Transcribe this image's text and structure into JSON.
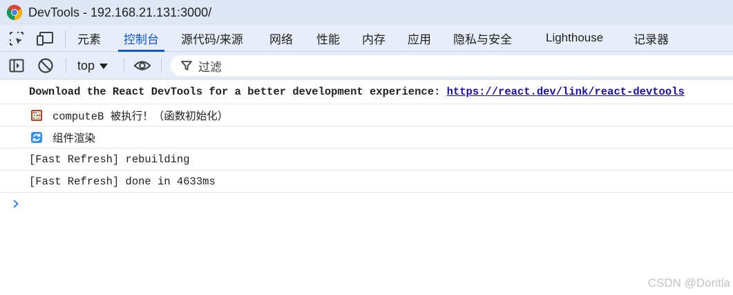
{
  "window": {
    "title": "DevTools - 192.168.21.131:3000/",
    "icon": "chrome-logo"
  },
  "tabs": [
    {
      "label": "元素",
      "active": false
    },
    {
      "label": "控制台",
      "active": true
    },
    {
      "label": "源代码/来源",
      "active": false
    },
    {
      "label": "网络",
      "active": false
    },
    {
      "label": "性能",
      "active": false
    },
    {
      "label": "内存",
      "active": false
    },
    {
      "label": "应用",
      "active": false
    },
    {
      "label": "隐私与安全",
      "active": false
    },
    {
      "label": "Lighthouse",
      "active": false
    },
    {
      "label": "记录器",
      "active": false
    }
  ],
  "toolbar": {
    "context": "top",
    "filter_placeholder": "过滤"
  },
  "messages": [
    {
      "prefix": "Download the React DevTools for a better development experience: ",
      "link": "https://react.dev/link/react-devtools"
    },
    {
      "icon": "abacus-emoji",
      "text": "computeB 被执行！（函数初始化）"
    },
    {
      "icon": "refresh-emoji",
      "text": "组件渲染"
    },
    {
      "text": "[Fast Refresh] rebuilding"
    },
    {
      "text": "[Fast Refresh] done in 4633ms"
    }
  ],
  "watermark": "CSDN @Dontla",
  "colors": {
    "accent": "#0b57d0",
    "link": "#1a0dab",
    "toolbar_bg": "#e8eef9",
    "title_bg": "#dfe7f6"
  }
}
